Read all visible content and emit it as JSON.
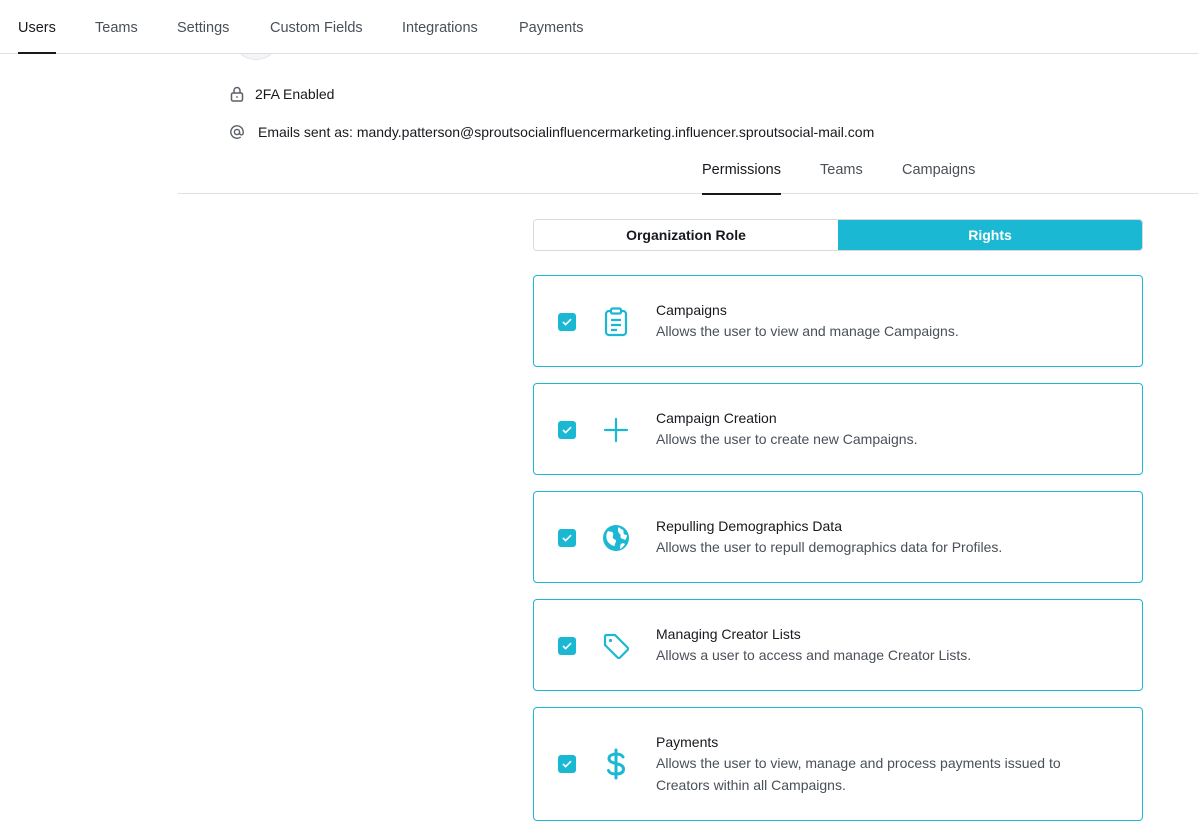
{
  "nav": {
    "tabs": [
      {
        "label": "Users"
      },
      {
        "label": "Teams"
      },
      {
        "label": "Settings"
      },
      {
        "label": "Custom Fields"
      },
      {
        "label": "Integrations"
      },
      {
        "label": "Payments"
      }
    ],
    "active": "Users"
  },
  "profile": {
    "twofa": "2FA Enabled",
    "email_sent_as": "Emails sent as: mandy.patterson@sproutsocialinfluencermarketing.influencer.sproutsocial-mail.com"
  },
  "subtabs": {
    "tabs": [
      {
        "label": "Permissions"
      },
      {
        "label": "Teams"
      },
      {
        "label": "Campaigns"
      }
    ],
    "active": "Permissions"
  },
  "segment": {
    "options": [
      {
        "label": "Organization Role"
      },
      {
        "label": "Rights"
      }
    ],
    "selected": "Rights"
  },
  "accent_color": "#1bb8d4",
  "rights": [
    {
      "title": "Campaigns",
      "description": "Allows the user to view and manage Campaigns.",
      "icon": "clipboard-icon",
      "checked": true
    },
    {
      "title": "Campaign Creation",
      "description": "Allows the user to create new Campaigns.",
      "icon": "plus-icon",
      "checked": true
    },
    {
      "title": "Repulling Demographics Data",
      "description": "Allows the user to repull demographics data for Profiles.",
      "icon": "globe-icon",
      "checked": true
    },
    {
      "title": "Managing Creator Lists",
      "description": "Allows a user to access and manage Creator Lists.",
      "icon": "tag-icon",
      "checked": true
    },
    {
      "title": "Payments",
      "description": "Allows the user to view, manage and process payments issued to Creators within all Campaigns.",
      "icon": "dollar-icon",
      "checked": true
    }
  ]
}
